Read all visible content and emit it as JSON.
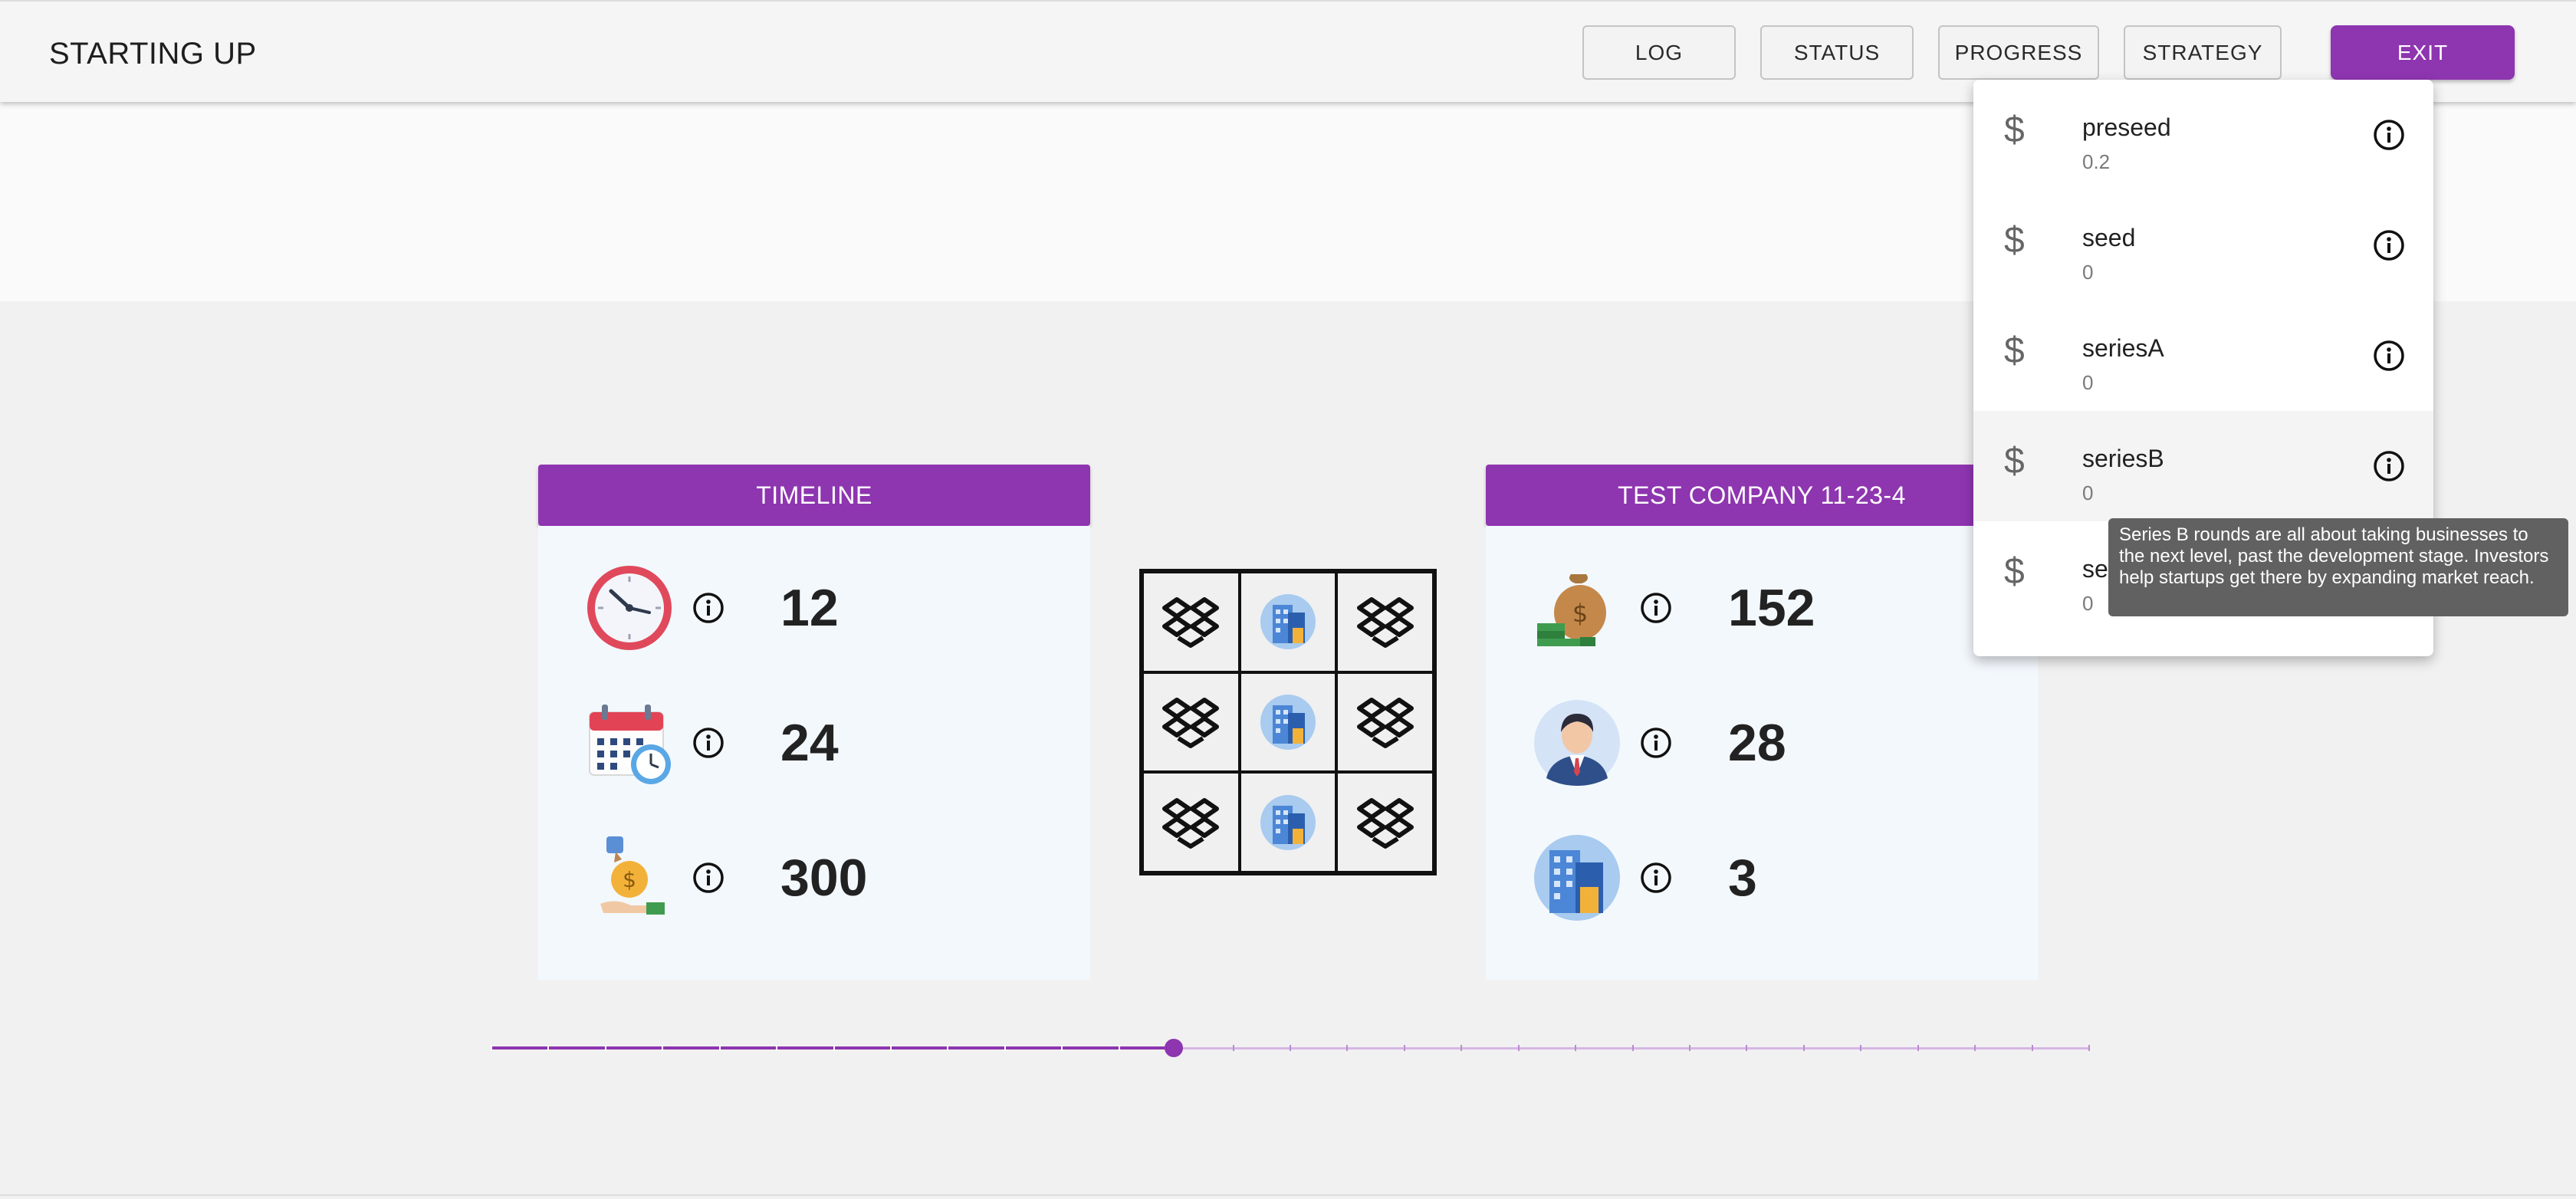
{
  "app": {
    "title": "STARTING UP"
  },
  "nav": {
    "log": "LOG",
    "status": "STATUS",
    "progress": "PROGRESS",
    "strategy": "STRATEGY",
    "exit": "EXIT"
  },
  "colors": {
    "accent": "#8e35b0",
    "panel_bg": "#f3f8fd",
    "tooltip_bg": "#616161"
  },
  "timeline": {
    "title": "TIMELINE",
    "stats": [
      {
        "icon": "clock-icon",
        "value": "12"
      },
      {
        "icon": "calendar-icon",
        "value": "24"
      },
      {
        "icon": "money-bag-hand-icon",
        "value": "300"
      }
    ]
  },
  "company": {
    "title": "TEST COMPANY 11-23-4",
    "stats": [
      {
        "icon": "cash-stack-icon",
        "value": "152"
      },
      {
        "icon": "employee-avatar-icon",
        "value": "28"
      },
      {
        "icon": "office-building-icon",
        "value": "3"
      }
    ]
  },
  "grid": {
    "cells": [
      "dropbox-icon",
      "building-icon",
      "dropbox-icon",
      "dropbox-icon",
      "building-icon",
      "dropbox-icon",
      "dropbox-icon",
      "building-icon",
      "dropbox-icon"
    ]
  },
  "slider": {
    "steps": 28,
    "current_step": 12
  },
  "menu": {
    "items": [
      {
        "name": "preseed",
        "value": "0.2"
      },
      {
        "name": "seed",
        "value": "0"
      },
      {
        "name": "seriesA",
        "value": "0"
      },
      {
        "name": "seriesB",
        "value": "0"
      },
      {
        "name": "se",
        "value": "0"
      }
    ]
  },
  "tooltip": {
    "text": "Series B rounds are all about taking businesses to the next level, past the development stage. Investors help startups get there by expanding market reach."
  }
}
